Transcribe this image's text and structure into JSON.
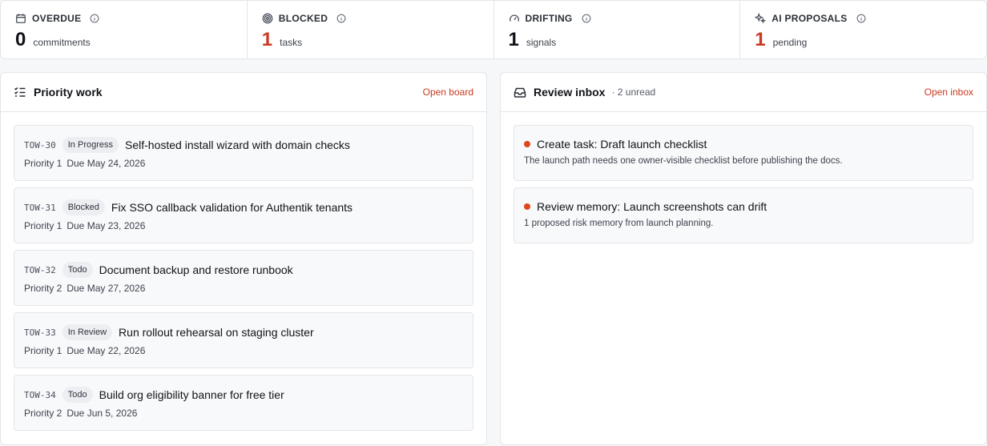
{
  "stats": [
    {
      "label": "OVERDUE",
      "value": "0",
      "unit": "commitments",
      "icon": "calendar-icon",
      "highlight": false
    },
    {
      "label": "BLOCKED",
      "value": "1",
      "unit": "tasks",
      "icon": "target-icon",
      "highlight": true
    },
    {
      "label": "DRIFTING",
      "value": "1",
      "unit": "signals",
      "icon": "gauge-icon",
      "highlight": false
    },
    {
      "label": "AI PROPOSALS",
      "value": "1",
      "unit": "pending",
      "icon": "sparkles-icon",
      "highlight": true
    }
  ],
  "priority": {
    "title": "Priority work",
    "link": "Open board",
    "tasks": [
      {
        "id": "TOW-30",
        "status": "In Progress",
        "title": "Self-hosted install wizard with domain checks",
        "priority": "Priority 1",
        "due": "Due May 24, 2026"
      },
      {
        "id": "TOW-31",
        "status": "Blocked",
        "title": "Fix SSO callback validation for Authentik tenants",
        "priority": "Priority 1",
        "due": "Due May 23, 2026"
      },
      {
        "id": "TOW-32",
        "status": "Todo",
        "title": "Document backup and restore runbook",
        "priority": "Priority 2",
        "due": "Due May 27, 2026"
      },
      {
        "id": "TOW-33",
        "status": "In Review",
        "title": "Run rollout rehearsal on staging cluster",
        "priority": "Priority 1",
        "due": "Due May 22, 2026"
      },
      {
        "id": "TOW-34",
        "status": "Todo",
        "title": "Build org eligibility banner for free tier",
        "priority": "Priority 2",
        "due": "Due Jun 5, 2026"
      }
    ]
  },
  "inbox": {
    "title": "Review inbox",
    "unread": "· 2 unread",
    "link": "Open inbox",
    "items": [
      {
        "title": "Create task: Draft launch checklist",
        "desc": "The launch path needs one owner-visible checklist before publishing the docs."
      },
      {
        "title": "Review memory: Launch screenshots can drift",
        "desc": "1 proposed risk memory from launch planning."
      }
    ]
  },
  "colors": {
    "accent": "#c93a22",
    "dot": "#e0461b",
    "border": "#e3e5e9"
  }
}
